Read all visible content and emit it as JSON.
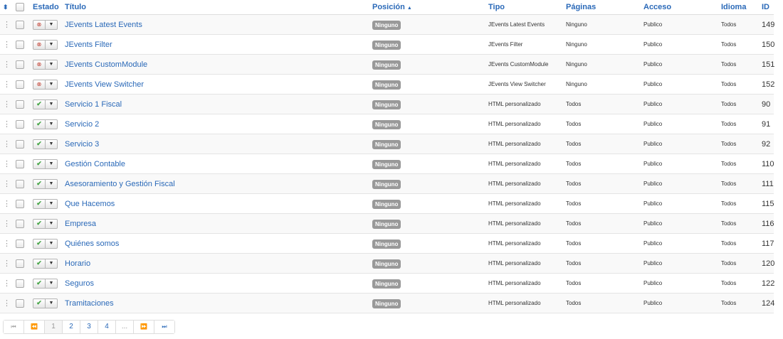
{
  "header": {
    "sort_icon": "sort-icon",
    "estado": "Estado",
    "titulo": "Título",
    "posicion": "Posición",
    "tipo": "Tipo",
    "paginas": "Páginas",
    "acceso": "Acceso",
    "idioma": "Idioma",
    "id": "ID"
  },
  "rows": [
    {
      "published": false,
      "title": "JEvents Latest Events",
      "position": "Ninguno",
      "type": "JEvents Latest Events",
      "pages": "Ninguno",
      "access": "Publico",
      "language": "Todos",
      "id": "149"
    },
    {
      "published": false,
      "title": "JEvents Filter",
      "position": "Ninguno",
      "type": "JEvents Filter",
      "pages": "Ninguno",
      "access": "Publico",
      "language": "Todos",
      "id": "150"
    },
    {
      "published": false,
      "title": "JEvents CustomModule",
      "position": "Ninguno",
      "type": "JEvents CustomModule",
      "pages": "Ninguno",
      "access": "Publico",
      "language": "Todos",
      "id": "151"
    },
    {
      "published": false,
      "title": "JEvents View Switcher",
      "position": "Ninguno",
      "type": "JEvents View Switcher",
      "pages": "Ninguno",
      "access": "Publico",
      "language": "Todos",
      "id": "152"
    },
    {
      "published": true,
      "title": "Servicio 1 Fiscal",
      "position": "Ninguno",
      "type": "HTML personalizado",
      "pages": "Todos",
      "access": "Publico",
      "language": "Todos",
      "id": "90"
    },
    {
      "published": true,
      "title": "Servicio 2",
      "position": "Ninguno",
      "type": "HTML personalizado",
      "pages": "Todos",
      "access": "Publico",
      "language": "Todos",
      "id": "91"
    },
    {
      "published": true,
      "title": "Servicio 3",
      "position": "Ninguno",
      "type": "HTML personalizado",
      "pages": "Todos",
      "access": "Publico",
      "language": "Todos",
      "id": "92"
    },
    {
      "published": true,
      "title": "Gestión Contable",
      "position": "Ninguno",
      "type": "HTML personalizado",
      "pages": "Todos",
      "access": "Publico",
      "language": "Todos",
      "id": "110"
    },
    {
      "published": true,
      "title": "Asesoramiento y Gestión Fiscal",
      "position": "Ninguno",
      "type": "HTML personalizado",
      "pages": "Todos",
      "access": "Publico",
      "language": "Todos",
      "id": "111"
    },
    {
      "published": true,
      "title": "Que Hacemos",
      "position": "Ninguno",
      "type": "HTML personalizado",
      "pages": "Todos",
      "access": "Publico",
      "language": "Todos",
      "id": "115"
    },
    {
      "published": true,
      "title": "Empresa",
      "position": "Ninguno",
      "type": "HTML personalizado",
      "pages": "Todos",
      "access": "Publico",
      "language": "Todos",
      "id": "116"
    },
    {
      "published": true,
      "title": "Quiénes somos",
      "position": "Ninguno",
      "type": "HTML personalizado",
      "pages": "Todos",
      "access": "Publico",
      "language": "Todos",
      "id": "117"
    },
    {
      "published": true,
      "title": "Horario",
      "position": "Ninguno",
      "type": "HTML personalizado",
      "pages": "Todos",
      "access": "Publico",
      "language": "Todos",
      "id": "120"
    },
    {
      "published": true,
      "title": "Seguros",
      "position": "Ninguno",
      "type": "HTML personalizado",
      "pages": "Todos",
      "access": "Publico",
      "language": "Todos",
      "id": "122"
    },
    {
      "published": true,
      "title": "Tramitaciones",
      "position": "Ninguno",
      "type": "HTML personalizado",
      "pages": "Todos",
      "access": "Publico",
      "language": "Todos",
      "id": "124"
    }
  ],
  "pagination": {
    "pages": [
      "1",
      "2",
      "3",
      "4"
    ],
    "ellipsis": "...",
    "active": "1"
  },
  "colors": {
    "link": "#2a69b8",
    "published": "#46a546",
    "unpublished": "#c0392b",
    "badge": "#999999"
  }
}
